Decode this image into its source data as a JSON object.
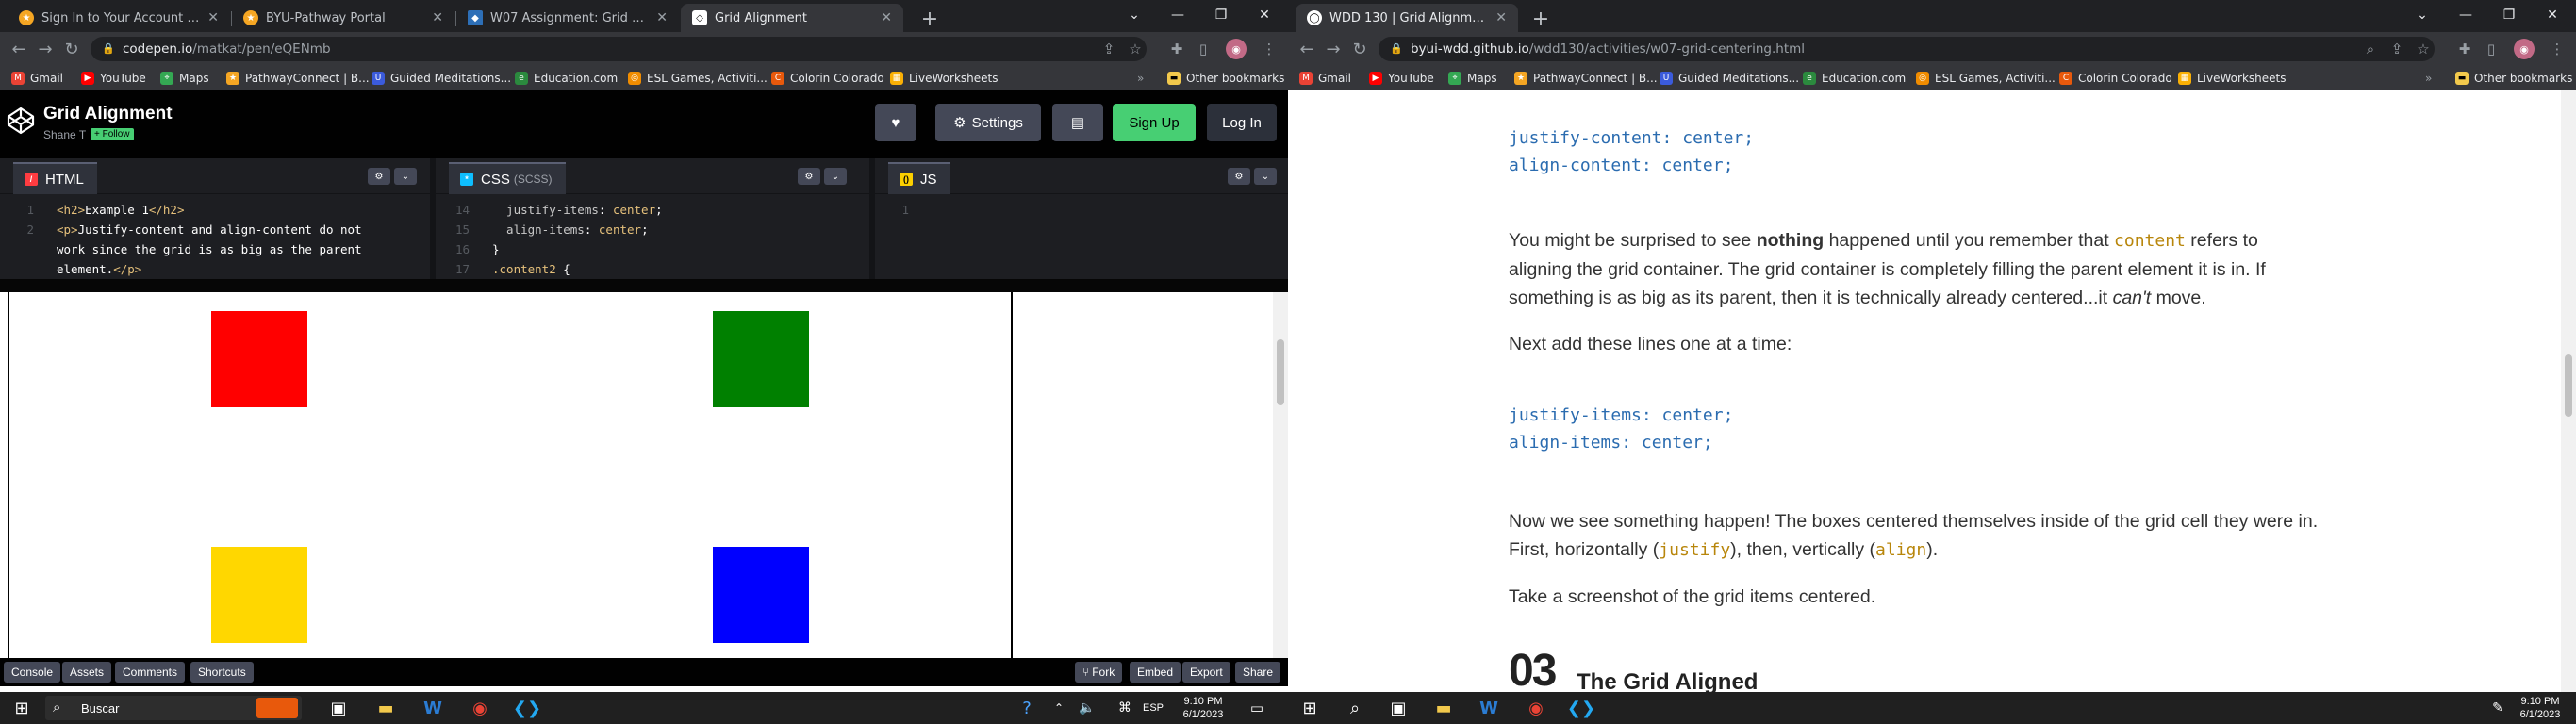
{
  "left_window": {
    "tabs": [
      {
        "title": "Sign In to Your Account | BYU-Pa",
        "active": false
      },
      {
        "title": "BYU-Pathway Portal",
        "active": false
      },
      {
        "title": "W07 Assignment: Grid Alignment",
        "active": false
      },
      {
        "title": "Grid Alignment",
        "active": true
      }
    ],
    "url_host": "codepen.io",
    "url_path": "/matkat/pen/eQENmb",
    "bookmarks": [
      "Gmail",
      "YouTube",
      "Maps",
      "PathwayConnect | B...",
      "Guided Meditations...",
      "Education.com",
      "ESL Games, Activiti...",
      "Colorin Colorado",
      "LiveWorksheets"
    ],
    "other_bookmarks": "Other bookmarks",
    "codepen": {
      "title": "Grid Alignment",
      "author": "Shane T",
      "follow": "+ Follow",
      "buttons": {
        "settings": "Settings",
        "signup": "Sign Up",
        "login": "Log In"
      },
      "panes": [
        {
          "name": "HTML",
          "sub": ""
        },
        {
          "name": "CSS",
          "sub": "(SCSS)"
        },
        {
          "name": "JS",
          "sub": ""
        }
      ],
      "html_code": [
        {
          "ln": "1",
          "parts": [
            [
              "tag",
              "<h2>"
            ],
            [
              "txt",
              "Example 1"
            ],
            [
              "tag",
              "</h2>"
            ]
          ]
        },
        {
          "ln": "2",
          "parts": [
            [
              "tag",
              "<p>"
            ],
            [
              "txt",
              "Justify-content and align-content do not"
            ]
          ]
        },
        {
          "ln": "",
          "parts": [
            [
              "txt",
              "work since the grid is as big as the parent"
            ]
          ]
        },
        {
          "ln": "",
          "parts": [
            [
              "txt",
              "element."
            ],
            [
              "tag",
              "</p>"
            ]
          ]
        }
      ],
      "css_code": [
        {
          "ln": "14",
          "parts": [
            [
              "prop",
              "  justify-items"
            ],
            [
              "txt",
              ": "
            ],
            [
              "val",
              "center"
            ],
            [
              "txt",
              ";"
            ]
          ]
        },
        {
          "ln": "15",
          "parts": [
            [
              "prop",
              "  align-items"
            ],
            [
              "txt",
              ": "
            ],
            [
              "val",
              "center"
            ],
            [
              "txt",
              ";"
            ]
          ]
        },
        {
          "ln": "16",
          "parts": [
            [
              "txt",
              "}"
            ]
          ]
        },
        {
          "ln": "17",
          "parts": [
            [
              "sel",
              ".content2"
            ],
            [
              "txt",
              " {"
            ]
          ]
        }
      ],
      "js_code": [
        {
          "ln": "1",
          "parts": []
        }
      ],
      "preview_boxes": [
        {
          "color": "#ff0000"
        },
        {
          "color": "#008000"
        },
        {
          "color": "#ffd700"
        },
        {
          "color": "#0000ff"
        }
      ],
      "footer_left": [
        "Console",
        "Assets",
        "Comments",
        "Shortcuts"
      ],
      "footer_right": [
        "Fork",
        "Embed",
        "Export",
        "Share"
      ]
    }
  },
  "right_window": {
    "tabs": [
      {
        "title": "WDD 130 | Grid Alignment",
        "active": true
      }
    ],
    "url_host": "byui-wdd.github.io",
    "url_path": "/wdd130/activities/w07-grid-centering.html",
    "bookmarks": [
      "Gmail",
      "YouTube",
      "Maps",
      "PathwayConnect | B...",
      "Guided Meditations...",
      "Education.com",
      "ESL Games, Activiti...",
      "Colorin Colorado",
      "LiveWorksheets"
    ],
    "other_bookmarks": "Other bookmarks",
    "article": {
      "code1": [
        "justify-content: center;",
        "align-content: center;"
      ],
      "p1_a": "You might be surprised to see ",
      "p1_b": "nothing",
      "p1_c": " happened until you remember that ",
      "p1_d": "content",
      "p1_e": " refers to aligning the grid container. The grid container is completely filling the parent element it is in. If something is as big as its parent, then it is technically already centered...it ",
      "p1_f": "can't",
      "p1_g": " move.",
      "p2": "Next add these lines one at a time:",
      "code2": [
        "justify-items: center;",
        "align-items: center;"
      ],
      "p3_a": "Now we see something happen! The boxes centered themselves inside of the grid cell they were in. First, horizontally (",
      "p3_b": "justify",
      "p3_c": "), then, vertically (",
      "p3_d": "align",
      "p3_e": ").",
      "p4": "Take a screenshot of the grid items centered.",
      "section_num": "03",
      "section_title": "The Grid Aligned"
    }
  },
  "taskbar": {
    "search": "Buscar",
    "lang": "ESP",
    "time": "9:10 PM",
    "date": "6/1/2023"
  }
}
